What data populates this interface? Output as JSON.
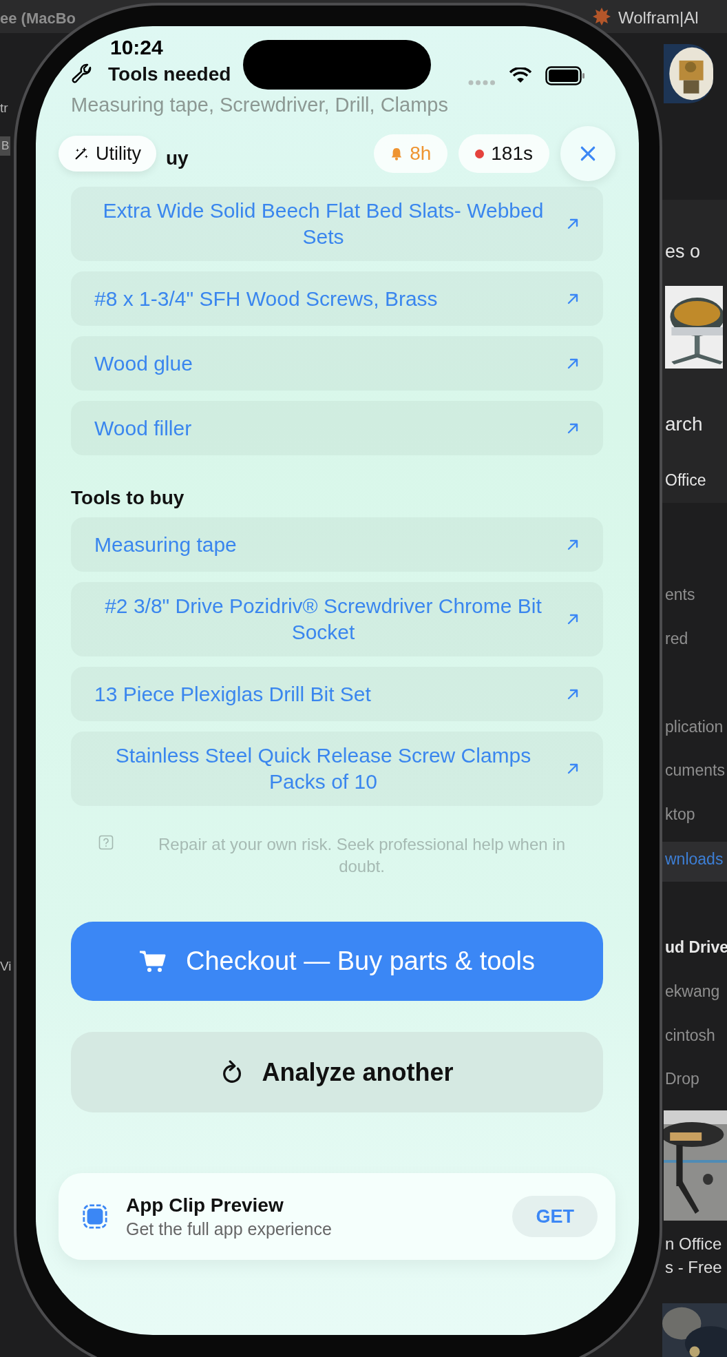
{
  "desktop": {
    "window_title": "ee (MacBo",
    "menu_app": "Wolfram|Al",
    "left_fragments": [
      "tr",
      "B",
      "Vi"
    ],
    "browser": {
      "heading": "es o",
      "link": "arch",
      "source": "Office"
    },
    "sidebar": [
      {
        "label": "ents",
        "kind": "item",
        "selected": false
      },
      {
        "label": "red",
        "kind": "item",
        "selected": false
      },
      {
        "label": "plication",
        "kind": "item",
        "selected": false
      },
      {
        "label": "cuments",
        "kind": "item",
        "selected": false
      },
      {
        "label": "ktop",
        "kind": "item",
        "selected": false
      },
      {
        "label": "wnloads",
        "kind": "item",
        "selected": true
      },
      {
        "label": "ud Drive",
        "kind": "heading",
        "selected": false
      },
      {
        "label": "ekwang",
        "kind": "item",
        "selected": false
      },
      {
        "label": "cintosh",
        "kind": "item",
        "selected": false
      },
      {
        "label": "Drop",
        "kind": "item",
        "selected": false
      }
    ],
    "result": {
      "title": "n Office",
      "subtitle": "s - Free"
    }
  },
  "status_bar": {
    "time": "10:24"
  },
  "header": {
    "title": "Tools needed",
    "subtitle": "Measuring tape, Screwdriver, Drill, Clamps"
  },
  "toolbar": {
    "mode": "Utility",
    "reminder": "8h",
    "timer": "181s",
    "recording": true
  },
  "parts": {
    "title": "uy",
    "items": [
      "Extra Wide Solid Beech Flat Bed Slats- Webbed Sets",
      "#8 x 1-3/4\" SFH Wood Screws, Brass",
      "Wood glue",
      "Wood filler"
    ]
  },
  "tools": {
    "title": "Tools to buy",
    "items": [
      "Measuring tape",
      "#2 3/8\" Drive Pozidriv® Screwdriver Chrome Bit Socket",
      "13 Piece Plexiglas Drill Bit Set",
      "Stainless Steel Quick Release Screw Clamps Packs of 10"
    ]
  },
  "disclaimer": "Repair at your own risk. Seek professional help when in doubt.",
  "checkout_button": "Checkout — Buy parts & tools",
  "analyze_button": "Analyze another",
  "app_clip": {
    "title": "App Clip Preview",
    "subtitle": "Get the full app experience",
    "button": "GET"
  }
}
